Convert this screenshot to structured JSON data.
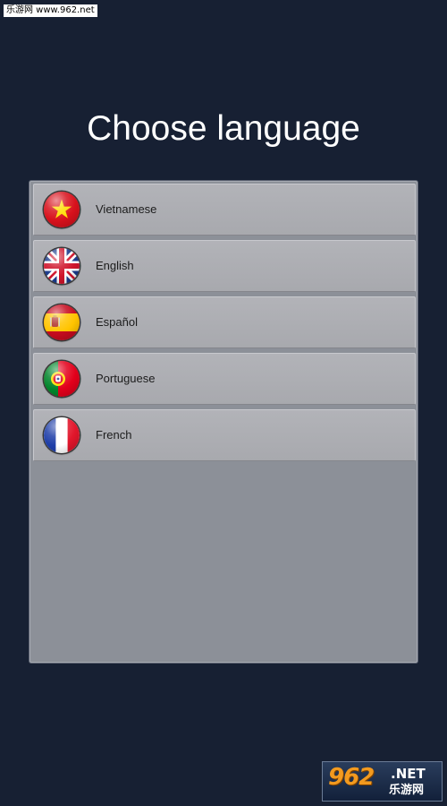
{
  "watermark_top": "乐游网 www.962.net",
  "title": "Choose language",
  "languages": [
    {
      "label": "Vietnamese",
      "flag": "vietnam-flag-icon"
    },
    {
      "label": "English",
      "flag": "uk-flag-icon"
    },
    {
      "label": "Español",
      "flag": "spain-flag-icon"
    },
    {
      "label": "Portuguese",
      "flag": "portugal-flag-icon"
    },
    {
      "label": "French",
      "flag": "france-flag-icon"
    }
  ],
  "watermark_bottom": {
    "number": "962",
    "suffix": ".NET",
    "cn": "乐游网"
  },
  "colors": {
    "background": "#172033",
    "panel": "#8c9098",
    "item": "#acadb2",
    "title_text": "#ffffff",
    "item_text": "#1c1c1c"
  }
}
